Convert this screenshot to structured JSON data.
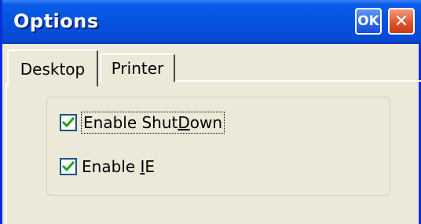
{
  "window": {
    "title": "Options",
    "ok_label": "OK",
    "close_label": "✕"
  },
  "tabs": [
    {
      "label": "Desktop",
      "selected": true
    },
    {
      "label": "Printer",
      "selected": false
    }
  ],
  "checkboxes": [
    {
      "label_pre": "Enable Shut",
      "label_accel": "D",
      "label_post": "own",
      "checked": true,
      "focused": true
    },
    {
      "label_pre": "Enable ",
      "label_accel": "I",
      "label_post": "E",
      "checked": true,
      "focused": false
    }
  ],
  "colors": {
    "titlebar": "#0551e0",
    "close_button": "#e0502a",
    "check_mark": "#21a121",
    "window_bg": "#ece9d8"
  },
  "icons": {
    "check": "check-mark-icon"
  }
}
